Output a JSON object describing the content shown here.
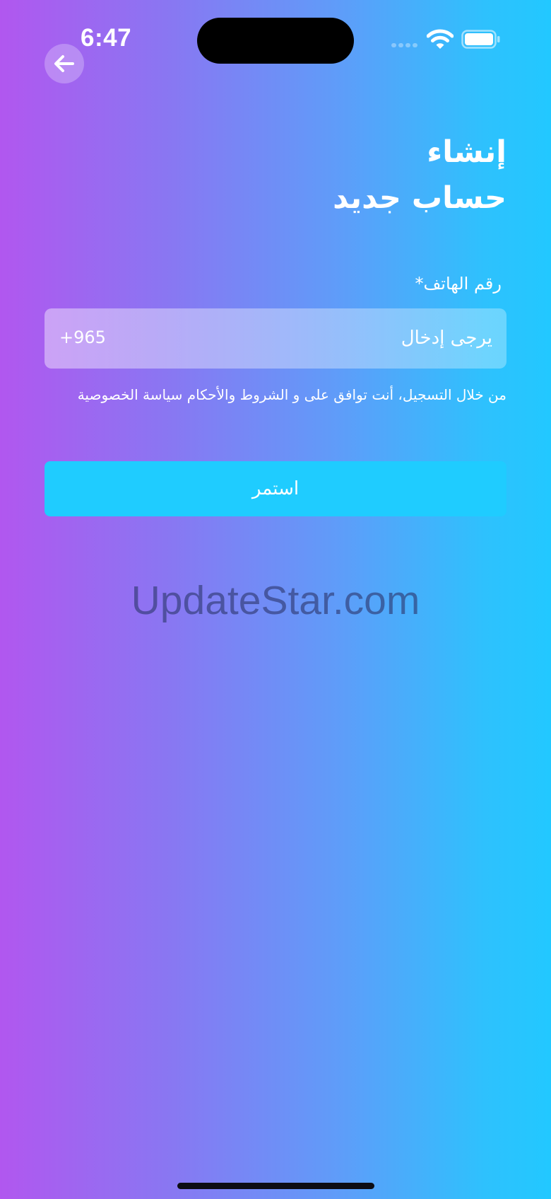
{
  "status_bar": {
    "time": "6:47",
    "wifi_icon": "wifi-icon",
    "battery_icon": "battery-icon"
  },
  "header": {
    "back_icon": "arrow-left-icon",
    "title_line1": "إنشاء",
    "title_line2": "حساب جديد"
  },
  "form": {
    "phone_label": "رقم الهاتف*",
    "country_code": "+965",
    "phone_placeholder": "يرجى إدخال",
    "phone_value": "",
    "terms_text": "من خلال التسجيل، أنت توافق على و الشروط والأحكام سياسة الخصوصية",
    "continue_label": "استمر"
  },
  "watermark": "UpdateStar.com",
  "colors": {
    "gradient_left": "#b157ef",
    "gradient_right": "#22c8ff",
    "button": "#1fccff"
  }
}
